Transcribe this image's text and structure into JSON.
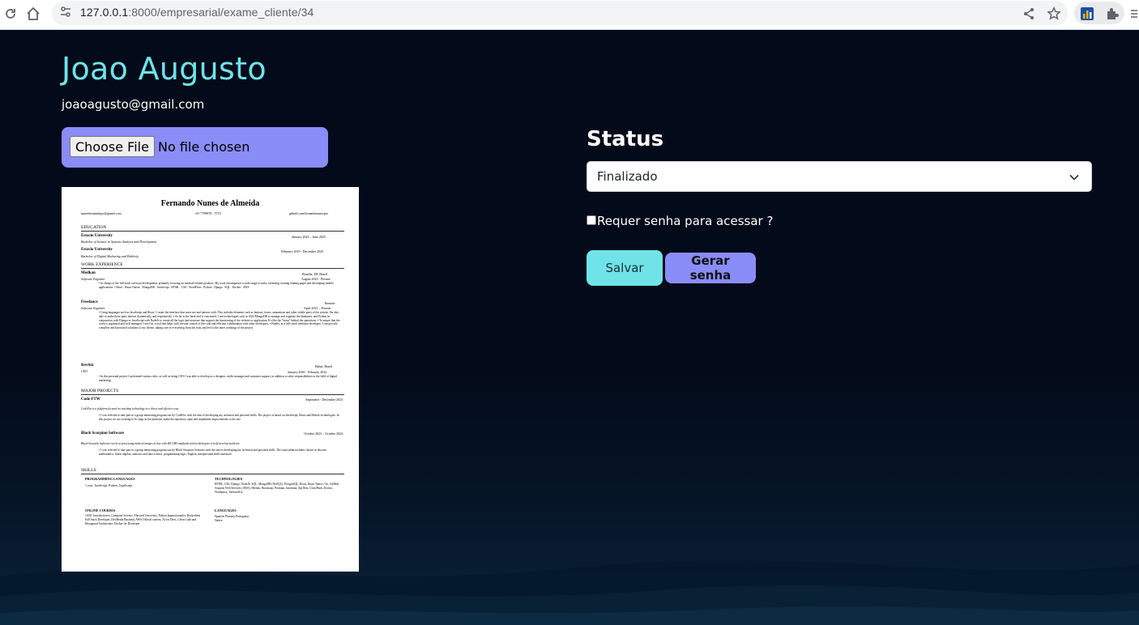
{
  "browser": {
    "url_host": "127.0.0.1",
    "url_rest": ":8000/empresarial/exame_cliente/34"
  },
  "candidate": {
    "name": "Joao Augusto",
    "email": "joaoagusto@gmail.com"
  },
  "upload": {
    "button_label": "Choose File",
    "status_text": "No file chosen"
  },
  "resume": {
    "name": "Fernando Nunes de Almeida",
    "contact": [
      "nunesfernandopro@gmail.com",
      "+55 7799878 - 5710",
      "github.com/fernandonunespro"
    ],
    "sections": {
      "education": "EDUCATION",
      "work": "WORK EXPERIENCE",
      "projects": "MAJOR PROJECTS",
      "skills": "SKILLS"
    },
    "education": [
      {
        "school": "Estacio University",
        "date": "January 2023 – June 2025",
        "degree": "Bachelor of Science in Systems Analysis and Development"
      },
      {
        "school": "Estacio University",
        "date": "February 2019 - December 2020",
        "degree": "Bachelor of Digital Marketing and Publicity"
      }
    ],
    "work": [
      {
        "company": "Medkan",
        "location": "Brasília, DF, Brazil",
        "role": "Software Engineer",
        "date": "August 2023 - Present",
        "body": "• In charge of the full-stack software development, primarily focusing on medical-related products. My work encompasses a wide range of tasks, including creating landing pages and developing mobile applications. • React . React Native . MongoDB . JavaScript . HTML . CSS . WordPress . Python . Django . SQL . Docker . AWS"
      },
      {
        "company": "Freelance",
        "location": "Remote",
        "role": "Software Engineer",
        "date": "April 2021 – Present",
        "body": "• Using languages such as JavaScript and React, I create the interface that users see and interact with. This includes elements such as buttons, forms, animations and other visible parts of the system. I'm also able to make those parts interact dynamically and responsively. • As far as the back-end is concerned, I use technologies such as SQL/MongoDB to manage and organize the databases, and Python in conjunction with Django or JavaScript with NodeJs to create all the logic and structure that support the functioning of the website or application. It's like the \"brain\" behind the operations. • To ensure that the work is organized and well managed, I use Git, a tool that helps with version control of the code and efficient collaboration with other developers. • Finally, as a full-stack freelance developer, I can provide complete and functional solutions to my clients, taking care of everything from the look and feel to the inner workings of the project."
      },
      {
        "company": "Revittá",
        "location": "Bahia, Brazil",
        "role": "CEO",
        "date": "January 2020 - February 2022",
        "body": "• In this personal project I performed various roles, as well as being CEO I was able to develop as a designer, traffic manager and customer support, in addition to other responsibilities in the field of digital marketing."
      }
    ],
    "projects": [
      {
        "name": "Code FTW",
        "date": "September - December 2023",
        "tagline": "CodeFtw is a platform focused on teaching technology in a direct and effective way.",
        "body": "• I was selected to take part in a group mentoring program run by CodeFtw with the aim of developing my technical and personal skills. The project is based on JavaScript, React and Meteor technologies. In this project we are working to fix bugs in the platform, make the repository open and implement improvements to the site."
      },
      {
        "name": "Black Scorpion Software",
        "date": "October 2023 – October 2024",
        "tagline": "Black Scorpion Software excels at processing medical images in line with DICOM standards and technologies to help develop medicine.",
        "body": "• I was selected to take part in a group mentoring program run by Black Scorpion Software with the aim of developing my technical and personal skills. The curriculum includes classes in discrete mathematics, linear algebra, statistics and data science, programming logic, English, interpersonal skills and more."
      }
    ],
    "skills": {
      "prog_title": "PROGRAMMING LANGUAGES",
      "prog_body": "1 year: JavaScript, Python, TypeScript",
      "tech_title": "TECHNOLOGIES",
      "tech_body": "HTML, CSS, Django, NodeJS, SQL, MongoDB (NoSQL), PostgreSQL, React, React Native, Git, GitHub, Amazon Web Services (AWS), Heroku, Bootstrap, Postman, Insomnia, Api Rest, Unix/Bash, Docker, Wordpress, TailwindCss",
      "courses_title": "ONLINE COURSES",
      "courses_body": "CS50: Introduction to Computer Science | Harvard University, Python Impressionador, RocketSeat Full Stack Developer, DevMedia Backend, AWS Official content, AI for Devs, Clean Code and Hexagonal Architecture, Docker for Developer",
      "lang_title": "LANGUAGES",
      "lang_body": "Spanish: Fluently Portuguese: Native"
    }
  },
  "status": {
    "title": "Status",
    "selected": "Finalizado",
    "password_label": "Requer senha para acessar ?",
    "password_checked": false
  },
  "actions": {
    "save": "Salvar",
    "generate_password": "Gerar senha"
  },
  "colors": {
    "background": "#030a19",
    "accent_cyan": "#6fe3e8",
    "accent_purple": "#8a8cf8"
  }
}
